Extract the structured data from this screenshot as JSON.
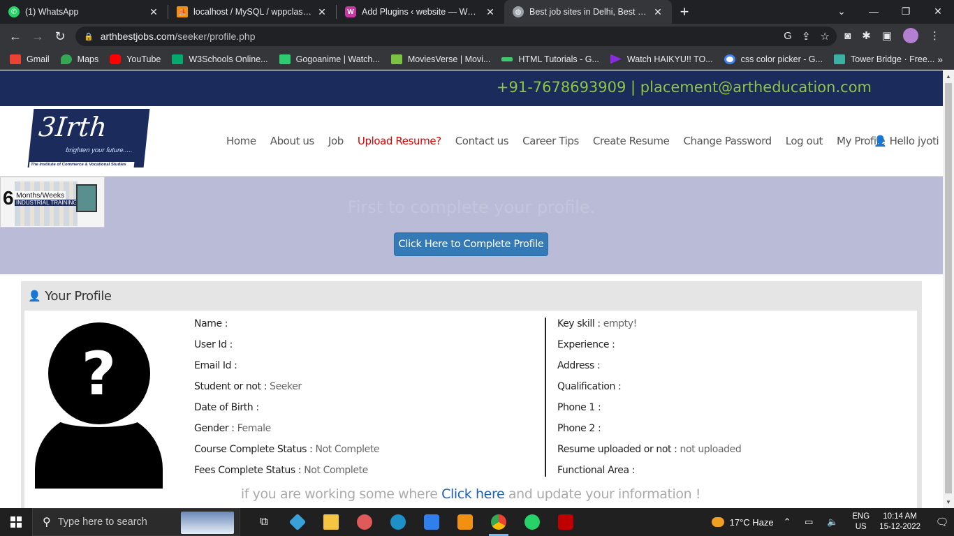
{
  "browser": {
    "tabs": [
      {
        "title": "(1) WhatsApp",
        "icon": "whatsapp-icon",
        "color": "#25d366"
      },
      {
        "title": "localhost / MySQL / wppclass | ph",
        "icon": "phpmyadmin-icon",
        "color": "#f29111"
      },
      {
        "title": "Add Plugins ‹ website — WordPr",
        "icon": "wordpress-icon",
        "color": "#c53aa0"
      },
      {
        "title": "Best job sites in Delhi, Best job sit",
        "icon": "globe-icon",
        "color": "#9aa0a6"
      }
    ],
    "url_host": "arthbestjobs.com",
    "url_path": "/seeker/profile.php",
    "bookmarks": [
      {
        "label": "Gmail",
        "color": "#ea4335"
      },
      {
        "label": "Maps",
        "color": "#34a853"
      },
      {
        "label": "YouTube",
        "color": "#ff0000"
      },
      {
        "label": "W3Schools Online...",
        "color": "#04aa6d"
      },
      {
        "label": "Gogoanime | Watch...",
        "color": "#2ecc71"
      },
      {
        "label": "MoviesVerse | Movi...",
        "color": "#7cc242"
      },
      {
        "label": "HTML Tutorials - G...",
        "color": "#3ccc6b"
      },
      {
        "label": "Watch HAIKYU!! TO...",
        "color": "#8a2be2"
      },
      {
        "label": "css color picker - G...",
        "color": "#4285f4"
      },
      {
        "label": "Tower Bridge · Free...",
        "color": "#3cb0a3"
      }
    ]
  },
  "site": {
    "contact": "+91-7678693909 | placement@artheducation.com",
    "logo": {
      "mark": "3Irth",
      "tagline": "brighten your future.....",
      "footer": "The Institute of Commerce & Vocational Studies"
    },
    "nav": [
      "Home",
      "About us",
      "Job",
      "Upload Resume?",
      "Contact us",
      "Career Tips",
      "Create Resume",
      "Change Password",
      "Log out",
      "My Profile"
    ],
    "hello": "Hello jyoti",
    "ad": {
      "number": "6",
      "line1": "Months/Weeks",
      "line2": "INDUSTRIAL TRAINING"
    },
    "banner_message": "First to complete your profile.",
    "complete_button": "Click Here to Complete Profile"
  },
  "profile": {
    "heading": "Your Profile",
    "left": [
      {
        "label": "Name :",
        "value": ""
      },
      {
        "label": "User Id :",
        "value": ""
      },
      {
        "label": "Email Id :",
        "value": ""
      },
      {
        "label": "Student or not :",
        "value": "Seeker"
      },
      {
        "label": "Date of Birth :",
        "value": ""
      },
      {
        "label": "Gender :",
        "value": "Female"
      },
      {
        "label": "Course Complete Status :",
        "value": "Not Complete"
      },
      {
        "label": "Fees Complete Status :",
        "value": "Not Complete"
      }
    ],
    "right": [
      {
        "label": "Key skill :",
        "value": "empty!"
      },
      {
        "label": "Experience :",
        "value": ""
      },
      {
        "label": "Address :",
        "value": ""
      },
      {
        "label": "Qualification :",
        "value": ""
      },
      {
        "label": "Phone 1 :",
        "value": ""
      },
      {
        "label": "Phone 2 :",
        "value": ""
      },
      {
        "label": "Resume uploaded or not :",
        "value": "not uploaded"
      },
      {
        "label": "Functional Area :",
        "value": ""
      }
    ],
    "working_prefix": "if you are working some where",
    "working_link": "Click here",
    "working_suffix": "and update your information !"
  },
  "taskbar": {
    "search_placeholder": "Type here to search",
    "weather": "17°C  Haze",
    "lang1": "ENG",
    "lang2": "US",
    "time": "10:14 AM",
    "date": "15-12-2022"
  }
}
